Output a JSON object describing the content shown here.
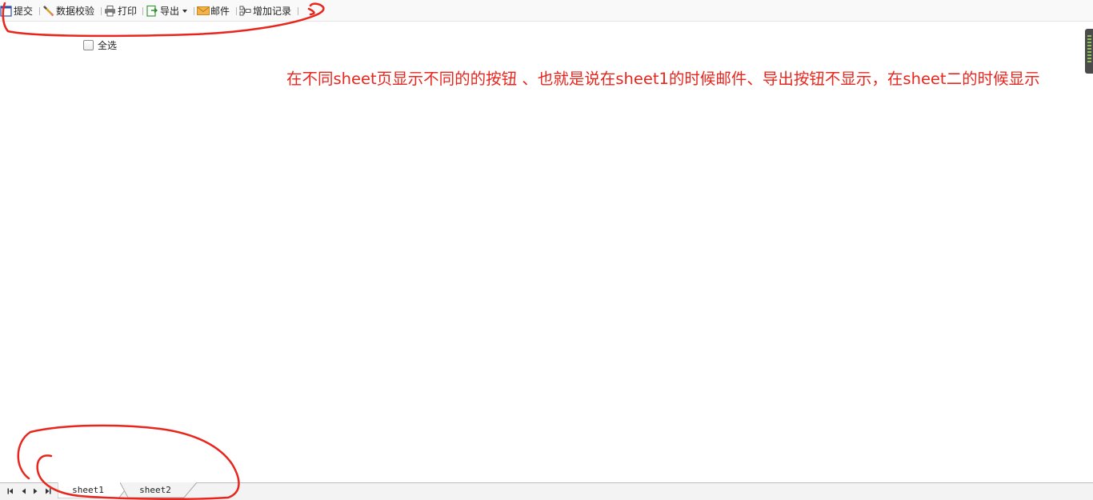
{
  "toolbar": {
    "submit_label": "提交",
    "validate_label": "数据校验",
    "print_label": "打印",
    "export_label": "导出",
    "mail_label": "邮件",
    "add_record_label": "增加记录"
  },
  "content": {
    "select_all_label": "全选",
    "select_all_checked": false,
    "annotation_text": "在不同sheet页显示不同的的按钮 、也就是说在sheet1的时候邮件、导出按钮不显示，在sheet二的时候显示"
  },
  "sheets": {
    "tabs": [
      {
        "label": "sheet1",
        "active": true
      },
      {
        "label": "sheet2",
        "active": false
      }
    ]
  },
  "colors": {
    "annotation_red": "#e8261d",
    "toolbar_bg": "#f9f9f9",
    "tabbar_bg": "#f3f3f3"
  },
  "icons": {
    "submit": "submit-icon",
    "validate": "ruler-pencil-icon",
    "print": "printer-icon",
    "export": "export-icon",
    "mail": "envelope-icon",
    "add_record": "add-record-icon",
    "nav_first": "first-sheet-icon",
    "nav_prev": "prev-sheet-icon",
    "nav_next": "next-sheet-icon",
    "nav_last": "last-sheet-icon"
  }
}
